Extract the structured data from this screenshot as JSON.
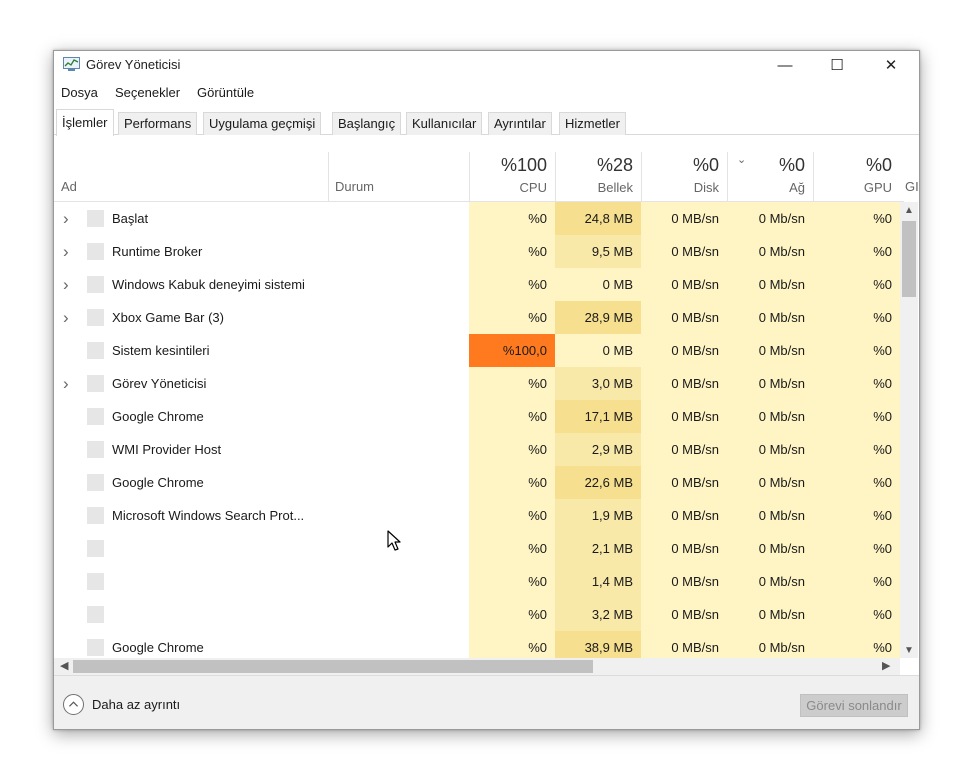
{
  "window": {
    "title": "Görev Yöneticisi",
    "controls": {
      "minimize": "—",
      "maximize": "☐",
      "close": "✕"
    }
  },
  "menu": [
    "Dosya",
    "Seçenekler",
    "Görüntüle"
  ],
  "tabs": [
    "İşlemler",
    "Performans",
    "Uygulama geçmişi",
    "Başlangıç",
    "Kullanıcılar",
    "Ayrıntılar",
    "Hizmetler"
  ],
  "active_tab": "İşlemler",
  "columns": {
    "name": "Ad",
    "status": "Durum",
    "cpu": {
      "pct": "%100",
      "label": "CPU"
    },
    "memory": {
      "pct": "%28",
      "label": "Bellek"
    },
    "disk": {
      "pct": "%0",
      "label": "Disk"
    },
    "network": {
      "pct": "%0",
      "label": "Ağ"
    },
    "gpu": {
      "pct": "%0",
      "label": "GPU"
    },
    "gpu_engine_partial": "GI"
  },
  "processes": [
    {
      "name": "Başlat",
      "expandable": true,
      "cpu": "%0",
      "memory": "24,8 MB",
      "disk": "0 MB/sn",
      "network": "0 Mb/sn",
      "gpu": "%0"
    },
    {
      "name": "Runtime Broker",
      "expandable": true,
      "cpu": "%0",
      "memory": "9,5 MB",
      "disk": "0 MB/sn",
      "network": "0 Mb/sn",
      "gpu": "%0"
    },
    {
      "name": "Windows Kabuk deneyimi sistemi",
      "expandable": true,
      "cpu": "%0",
      "memory": "0 MB",
      "disk": "0 MB/sn",
      "network": "0 Mb/sn",
      "gpu": "%0"
    },
    {
      "name": "Xbox Game Bar (3)",
      "expandable": true,
      "cpu": "%0",
      "memory": "28,9 MB",
      "disk": "0 MB/sn",
      "network": "0 Mb/sn",
      "gpu": "%0"
    },
    {
      "name": "Sistem kesintileri",
      "expandable": false,
      "cpu": "%100,0",
      "memory": "0 MB",
      "disk": "0 MB/sn",
      "network": "0 Mb/sn",
      "gpu": "%0"
    },
    {
      "name": "Görev Yöneticisi",
      "expandable": true,
      "cpu": "%0",
      "memory": "3,0 MB",
      "disk": "0 MB/sn",
      "network": "0 Mb/sn",
      "gpu": "%0"
    },
    {
      "name": "Google Chrome",
      "expandable": false,
      "cpu": "%0",
      "memory": "17,1 MB",
      "disk": "0 MB/sn",
      "network": "0 Mb/sn",
      "gpu": "%0"
    },
    {
      "name": "WMI Provider Host",
      "expandable": false,
      "cpu": "%0",
      "memory": "2,9 MB",
      "disk": "0 MB/sn",
      "network": "0 Mb/sn",
      "gpu": "%0"
    },
    {
      "name": "Google Chrome",
      "expandable": false,
      "cpu": "%0",
      "memory": "22,6 MB",
      "disk": "0 MB/sn",
      "network": "0 Mb/sn",
      "gpu": "%0"
    },
    {
      "name": "Microsoft Windows Search Prot...",
      "expandable": false,
      "cpu": "%0",
      "memory": "1,9 MB",
      "disk": "0 MB/sn",
      "network": "0 Mb/sn",
      "gpu": "%0"
    },
    {
      "name": "",
      "expandable": false,
      "cpu": "%0",
      "memory": "2,1 MB",
      "disk": "0 MB/sn",
      "network": "0 Mb/sn",
      "gpu": "%0"
    },
    {
      "name": "",
      "expandable": false,
      "cpu": "%0",
      "memory": "1,4 MB",
      "disk": "0 MB/sn",
      "network": "0 Mb/sn",
      "gpu": "%0"
    },
    {
      "name": "",
      "expandable": false,
      "cpu": "%0",
      "memory": "3,2 MB",
      "disk": "0 MB/sn",
      "network": "0 Mb/sn",
      "gpu": "%0"
    },
    {
      "name": "Google Chrome",
      "expandable": false,
      "cpu": "%0",
      "memory": "38,9 MB",
      "disk": "0 MB/sn",
      "network": "0 Mb/sn",
      "gpu": "%0"
    }
  ],
  "footer": {
    "fewer_details": "Daha az ayrıntı",
    "end_task": "Görevi sonlandır"
  },
  "colors": {
    "heat_light": "#fff4c4",
    "heat_medium": "#f9e9a8",
    "heat_high": "#ff7a1f",
    "accent_chrome": "#f0f0f0"
  }
}
